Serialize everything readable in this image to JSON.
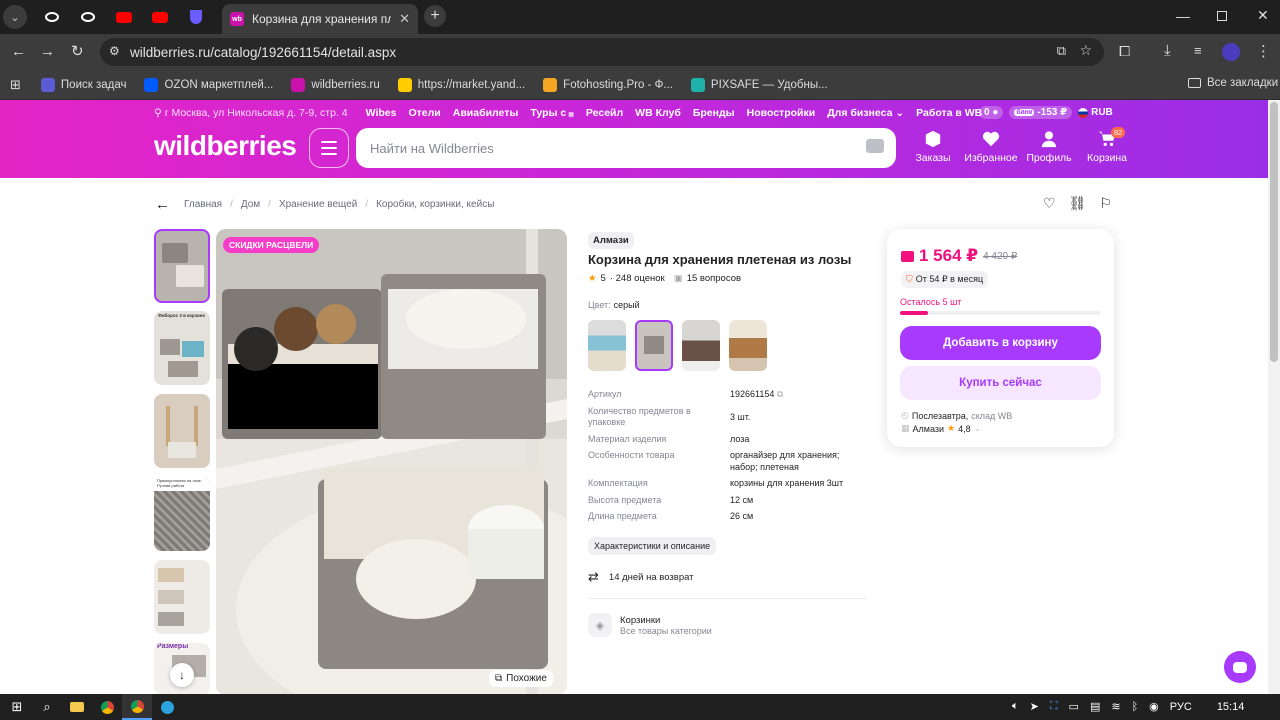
{
  "browser": {
    "tab_title": "Корзина для хранения плетена",
    "url": "wildberries.ru/catalog/192661154/detail.aspx",
    "bookmarks": [
      {
        "label": "Поиск задач",
        "icon": "u-icon",
        "color": "#5b5bd6"
      },
      {
        "label": "OZON маркетплей...",
        "icon": "ozon-icon",
        "color": "#005bff"
      },
      {
        "label": "wildberries.ru",
        "icon": "wb-icon",
        "color": "#cb11ab"
      },
      {
        "label": "https://market.yand...",
        "icon": "yandex-market-icon",
        "color": "#ffcc00"
      },
      {
        "label": "Fotohosting.Pro - Ф...",
        "icon": "f-icon",
        "color": "#f5a623"
      },
      {
        "label": "PIXSAFE — Удобны...",
        "icon": "pixsafe-icon",
        "color": "#20b2aa"
      }
    ],
    "all_bookmarks": "Все закладки"
  },
  "header": {
    "location": "г Москва, ул Никольская д. 7-9, стр. 4",
    "links": [
      "Wibes",
      "Отели",
      "Авиабилеты",
      "Туры с",
      "Ресейл",
      "WB Клуб",
      "Бренды",
      "Новостройки",
      "Для бизнеса",
      "Работа в WB"
    ],
    "wallet": "0",
    "bank": "банк",
    "bank_value": "-153 ₽",
    "currency": "RUB",
    "logo": "wildberries",
    "search_placeholder": "Найти на Wildberries",
    "nav": [
      {
        "label": "Заказы",
        "icon": "box-icon"
      },
      {
        "label": "Избранное",
        "icon": "heart-icon"
      },
      {
        "label": "Профиль",
        "icon": "user-icon"
      },
      {
        "label": "Корзина",
        "icon": "cart-icon"
      }
    ],
    "cart_count": "82"
  },
  "breadcrumb": [
    "Главная",
    "Дом",
    "Хранение вещей",
    "Коробки, корзинки, кейсы"
  ],
  "product": {
    "promo_badge": "СКИДКИ РАСЦВЕЛИ",
    "brand": "Алмази",
    "title": "Корзина для хранения плетеная из лозы",
    "rating": "5",
    "reviews": "· 248 оценок",
    "questions": "15 вопросов",
    "color_label": "Цвет:",
    "color_value": "серый",
    "similar": "Похожие",
    "thumb_texts": [
      "",
      "Фиборос 3 в корзине",
      "",
      "Прямоугольная на лозе. Ручная работа",
      "",
      "Размеры"
    ],
    "specs": [
      {
        "k": "Артикул",
        "v": "192661154"
      },
      {
        "k": "Количество предметов в упаковке",
        "v": "3 шт."
      },
      {
        "k": "Материал изделия",
        "v": "лоза"
      },
      {
        "k": "Особенности товара",
        "v": "органайзер для хранения; набор; плетеная"
      },
      {
        "k": "Комплектация",
        "v": "корзины для хранения 3шт"
      },
      {
        "k": "Высота предмета",
        "v": "12 см"
      },
      {
        "k": "Длина предмета",
        "v": "26 см"
      }
    ],
    "specs_button": "Характеристики и описание",
    "return_text": "14 дней на возврат",
    "category_title": "Корзинки",
    "category_sub": "Все товары категории"
  },
  "price_card": {
    "price": "1 564 ₽",
    "old_price": "4 420 ₽",
    "installment": "От 54 ₽ в месяц",
    "stock": "Осталось 5 шт",
    "stock_fraction": 0.14,
    "add_to_cart": "Добавить в корзину",
    "buy_now": "Купить сейчас",
    "delivery": "Послезавтра,",
    "warehouse": "склад WB",
    "seller": "Алмази",
    "seller_rating": "4,8"
  },
  "taskbar": {
    "lang": "РУС",
    "time": "15:14"
  }
}
